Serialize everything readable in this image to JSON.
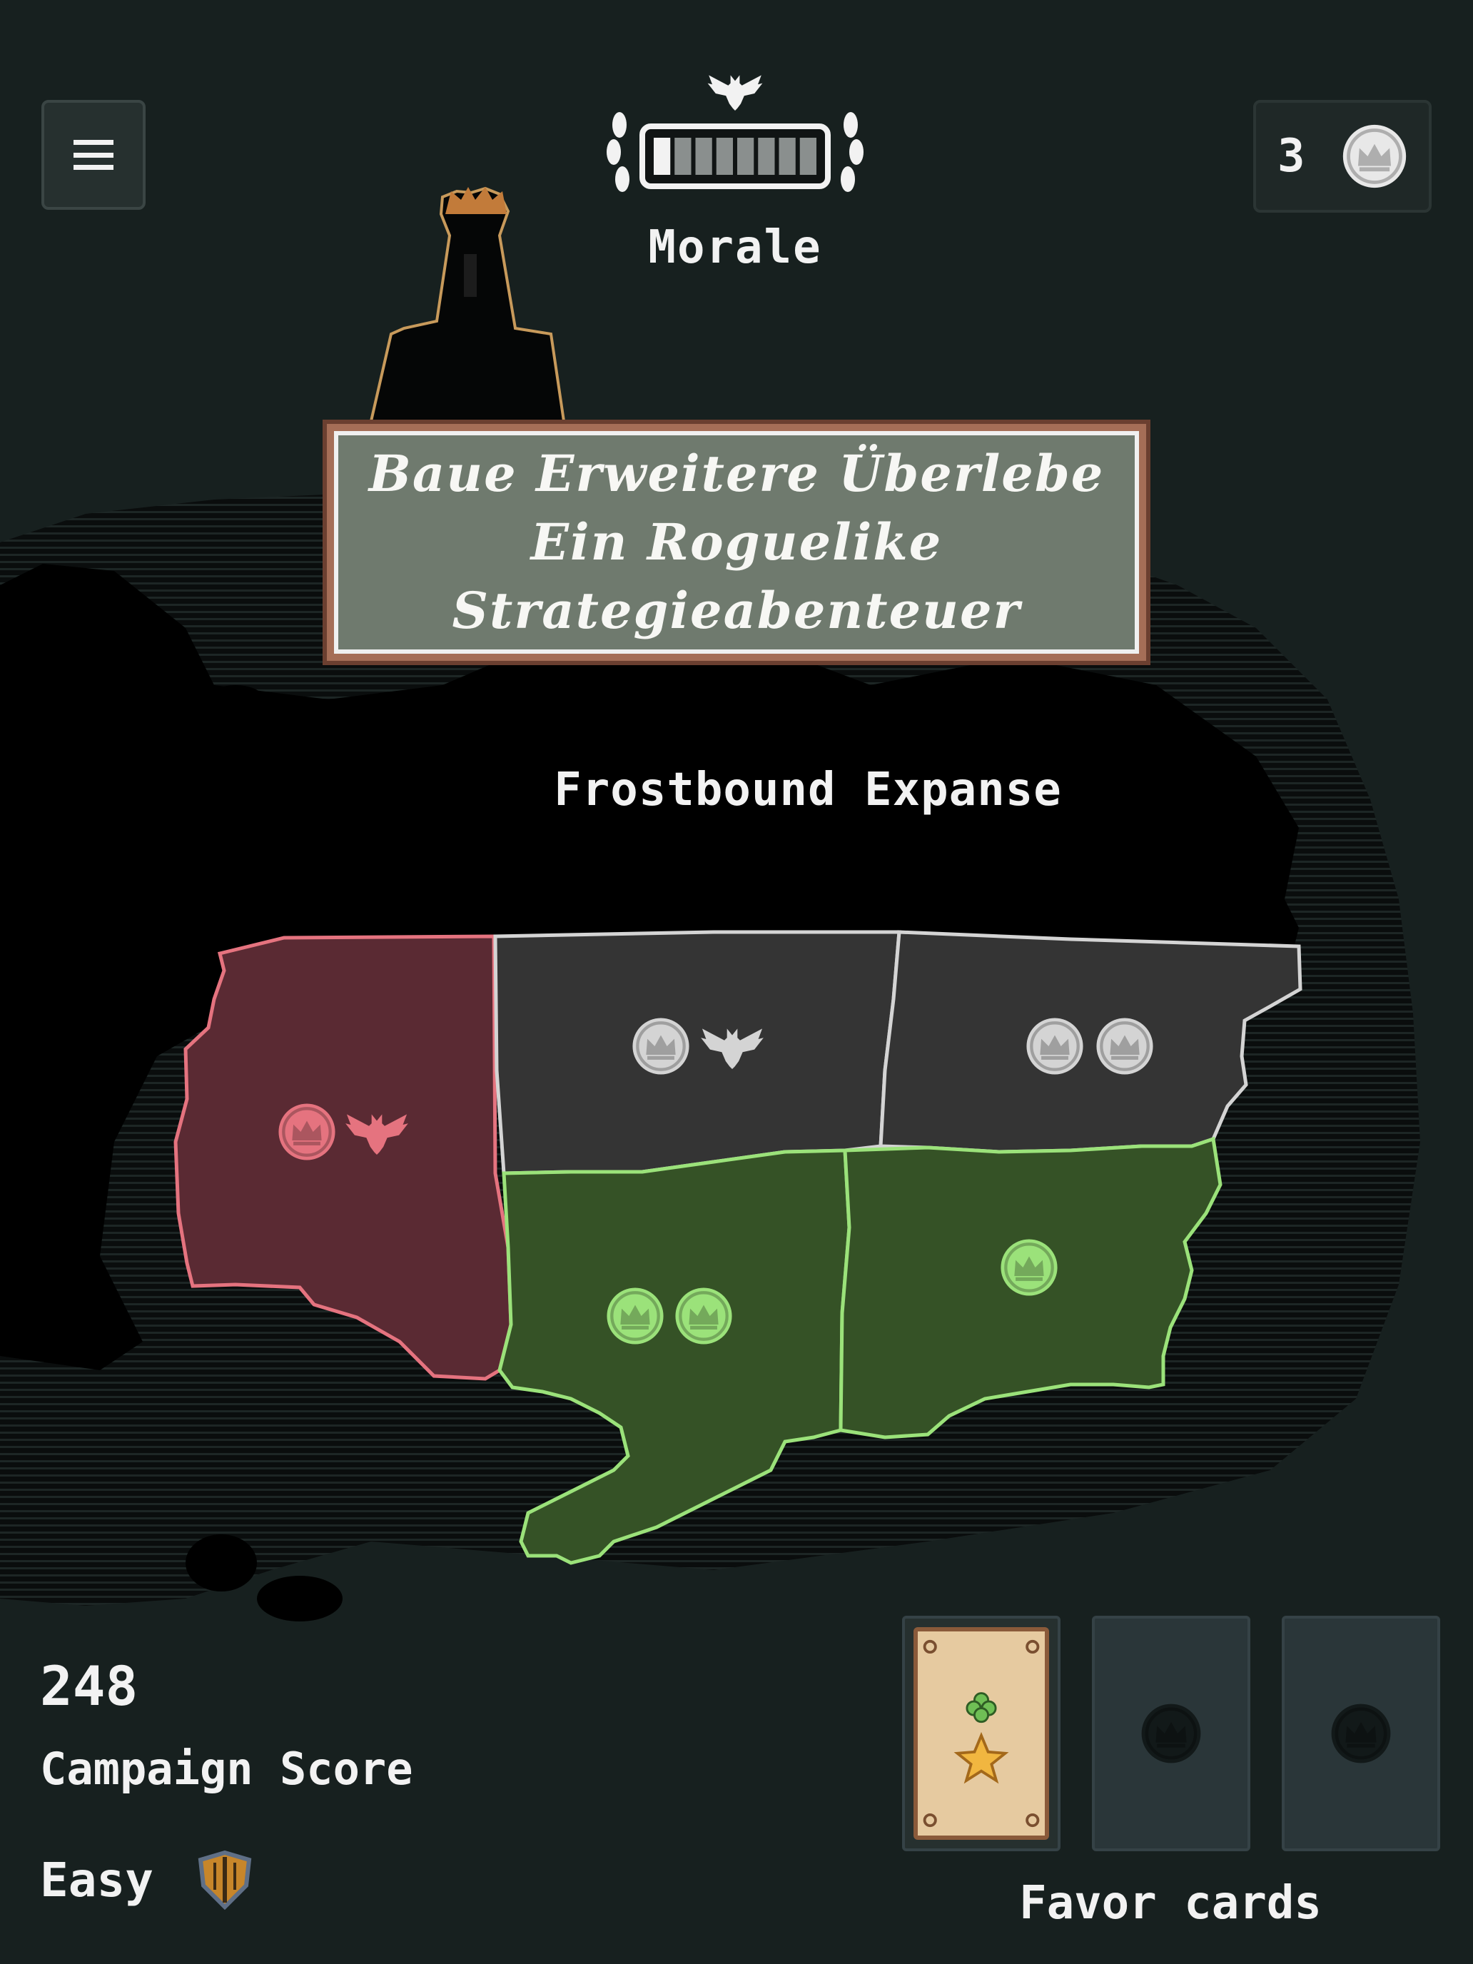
{
  "menu": {
    "icon": "hamburger-menu-icon"
  },
  "morale": {
    "label": "Morale",
    "level": 0.1,
    "segments": 8,
    "icons": [
      "eagle-icon",
      "laurel-wreath-icon"
    ]
  },
  "crowns": {
    "count": "3",
    "icon": "crown-icon"
  },
  "banner": {
    "lines": [
      "Baue Erweitere Überlebe",
      "Ein Roguelike",
      "Strategieabenteuer"
    ]
  },
  "map": {
    "title": "Frostbound Expanse",
    "regions": [
      {
        "name": "west",
        "status": "enemy",
        "color": "#5a2a33",
        "border": "#e5737f",
        "icons": [
          "crown-icon",
          "eagle-icon"
        ]
      },
      {
        "name": "north-center",
        "status": "neutral",
        "color": "#343434",
        "border": "#d4d4d4",
        "icons": [
          "crown-icon",
          "eagle-icon"
        ]
      },
      {
        "name": "north-east",
        "status": "neutral",
        "color": "#343434",
        "border": "#d4d4d4",
        "icons": [
          "crown-icon",
          "crown-icon"
        ]
      },
      {
        "name": "south-center",
        "status": "owned",
        "color": "#355226",
        "border": "#9be27a",
        "icons": [
          "crown-icon",
          "crown-icon"
        ]
      },
      {
        "name": "south-east",
        "status": "owned",
        "color": "#355226",
        "border": "#9be27a",
        "icons": [
          "crown-icon"
        ]
      }
    ]
  },
  "campaign": {
    "score": "248",
    "score_label": "Campaign Score",
    "difficulty": "Easy",
    "difficulty_icon": "shield-icon"
  },
  "favor": {
    "label": "Favor cards",
    "slots": [
      {
        "state": "filled",
        "icons": [
          "clover-icon",
          "star-icon"
        ]
      },
      {
        "state": "empty",
        "icon": "crown-icon"
      },
      {
        "state": "empty",
        "icon": "crown-icon"
      }
    ]
  },
  "colors": {
    "background": "#17201f",
    "fog": "#000000",
    "enemy": "#e5737f",
    "neutral": "#d4d4d4",
    "owned": "#9be27a",
    "banner_frame": "#a56e57",
    "banner_fill": "#6f7a6e"
  }
}
